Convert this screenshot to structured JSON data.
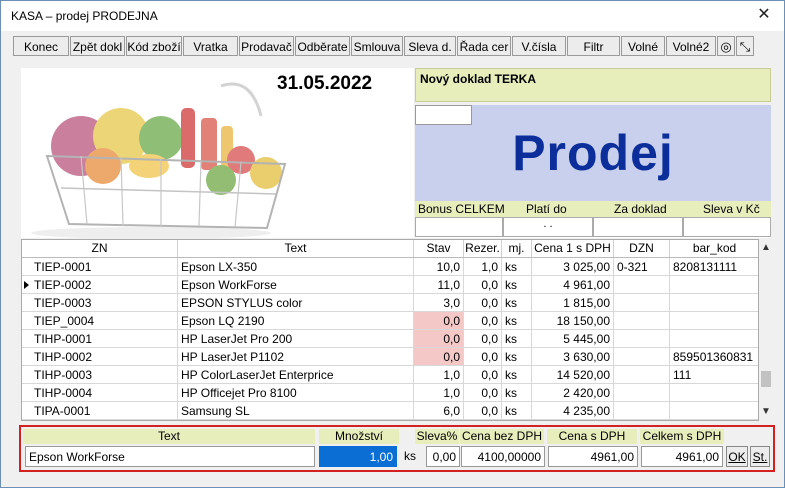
{
  "window": {
    "title": "KASA – prodej PRODEJNA",
    "close_glyph": "✕"
  },
  "toolbar": [
    {
      "label": "Konec"
    },
    {
      "label": "Zpět dokl"
    },
    {
      "label": "Kód zboží"
    },
    {
      "label": "Vratka"
    },
    {
      "label": "Prodavač"
    },
    {
      "label": "Odběrate"
    },
    {
      "label": "Smlouva"
    },
    {
      "label": "Sleva d."
    },
    {
      "label": "Řada cer"
    },
    {
      "label": "V.čísla"
    },
    {
      "label": "Filtr"
    },
    {
      "label": "Volné"
    },
    {
      "label": "Volné2"
    },
    {
      "label": "◎"
    },
    {
      "label": "⤡"
    }
  ],
  "header": {
    "date": "31.05.2022",
    "doc_label": "Nový doklad  TERKA",
    "mode": "Prodej"
  },
  "bonus": {
    "labels": [
      "Bonus CELKEM",
      "Platí do",
      "Za doklad",
      "Sleva v Kč"
    ],
    "plati_do_value": ". ."
  },
  "grid": {
    "columns": [
      "ZN",
      "Text",
      "Stav",
      "Rezer.",
      "mj.",
      "Cena 1 s DPH",
      "DZN",
      "bar_kod"
    ],
    "rows": [
      {
        "zn": "TIEP-0001",
        "text": "Epson LX-350",
        "stav": "10,0",
        "rez": "1,0",
        "mj": "ks",
        "cena": "3 025,00",
        "dzn": "0-321",
        "bar": "8208131111",
        "pink": false,
        "current": false
      },
      {
        "zn": "TIEP-0002",
        "text": "Epson WorkForse",
        "stav": "11,0",
        "rez": "0,0",
        "mj": "ks",
        "cena": "4 961,00",
        "dzn": "",
        "bar": "",
        "pink": false,
        "current": true
      },
      {
        "zn": "TIEP-0003",
        "text": "EPSON STYLUS color",
        "stav": "3,0",
        "rez": "0,0",
        "mj": "ks",
        "cena": "1 815,00",
        "dzn": "",
        "bar": "",
        "pink": false,
        "current": false
      },
      {
        "zn": "TIEP_0004",
        "text": "Epson LQ 2190",
        "stav": "0,0",
        "rez": "0,0",
        "mj": "ks",
        "cena": "18 150,00",
        "dzn": "",
        "bar": "",
        "pink": true,
        "current": false
      },
      {
        "zn": "TIHP-0001",
        "text": "HP LaserJet Pro 200",
        "stav": "0,0",
        "rez": "0,0",
        "mj": "ks",
        "cena": "5 445,00",
        "dzn": "",
        "bar": "",
        "pink": true,
        "current": false
      },
      {
        "zn": "TIHP-0002",
        "text": "HP LaserJet P1102",
        "stav": "0,0",
        "rez": "0,0",
        "mj": "ks",
        "cena": "3 630,00",
        "dzn": "",
        "bar": "859501360831",
        "pink": true,
        "current": false
      },
      {
        "zn": "TIHP-0003",
        "text": "HP ColorLaserJet Enterprice",
        "stav": "1,0",
        "rez": "0,0",
        "mj": "ks",
        "cena": "14 520,00",
        "dzn": "",
        "bar": "111",
        "pink": false,
        "current": false
      },
      {
        "zn": "TIHP-0004",
        "text": "HP Officejet Pro 8100",
        "stav": "1,0",
        "rez": "0,0",
        "mj": "ks",
        "cena": "2 420,00",
        "dzn": "",
        "bar": "",
        "pink": false,
        "current": false
      },
      {
        "zn": "TIPA-0001",
        "text": "Samsung SL",
        "stav": "6,0",
        "rez": "0,0",
        "mj": "ks",
        "cena": "4 235,00",
        "dzn": "",
        "bar": "",
        "pink": false,
        "current": false
      }
    ]
  },
  "entry": {
    "headers": {
      "text": "Text",
      "mnozstvi": "Množství",
      "sleva": "Sleva%",
      "cena_bez": "Cena bez DPH",
      "cena_s": "Cena s DPH",
      "celkem": "Celkem s DPH"
    },
    "values": {
      "text": "Epson WorkForse",
      "mnozstvi": "1,00",
      "mj": "ks",
      "sleva": "0,00",
      "cena_bez": "4100,00000",
      "cena_s": "4961,00",
      "celkem": "4961,00"
    },
    "ok_label": "OK",
    "st_label": "St."
  },
  "colors": {
    "accent_blue": "#0b2e9b",
    "panel_yellow": "#e8edbc",
    "prodej_bg": "#c8d0ee",
    "highlight_red": "#d32020",
    "stock_zero": "#f5c8c8"
  },
  "icons": {
    "close": "close-icon",
    "scroll_up": "chevron-up-icon",
    "scroll_down": "chevron-down-icon",
    "row_pointer": "row-pointer-icon",
    "basket": "shopping-basket-image"
  }
}
